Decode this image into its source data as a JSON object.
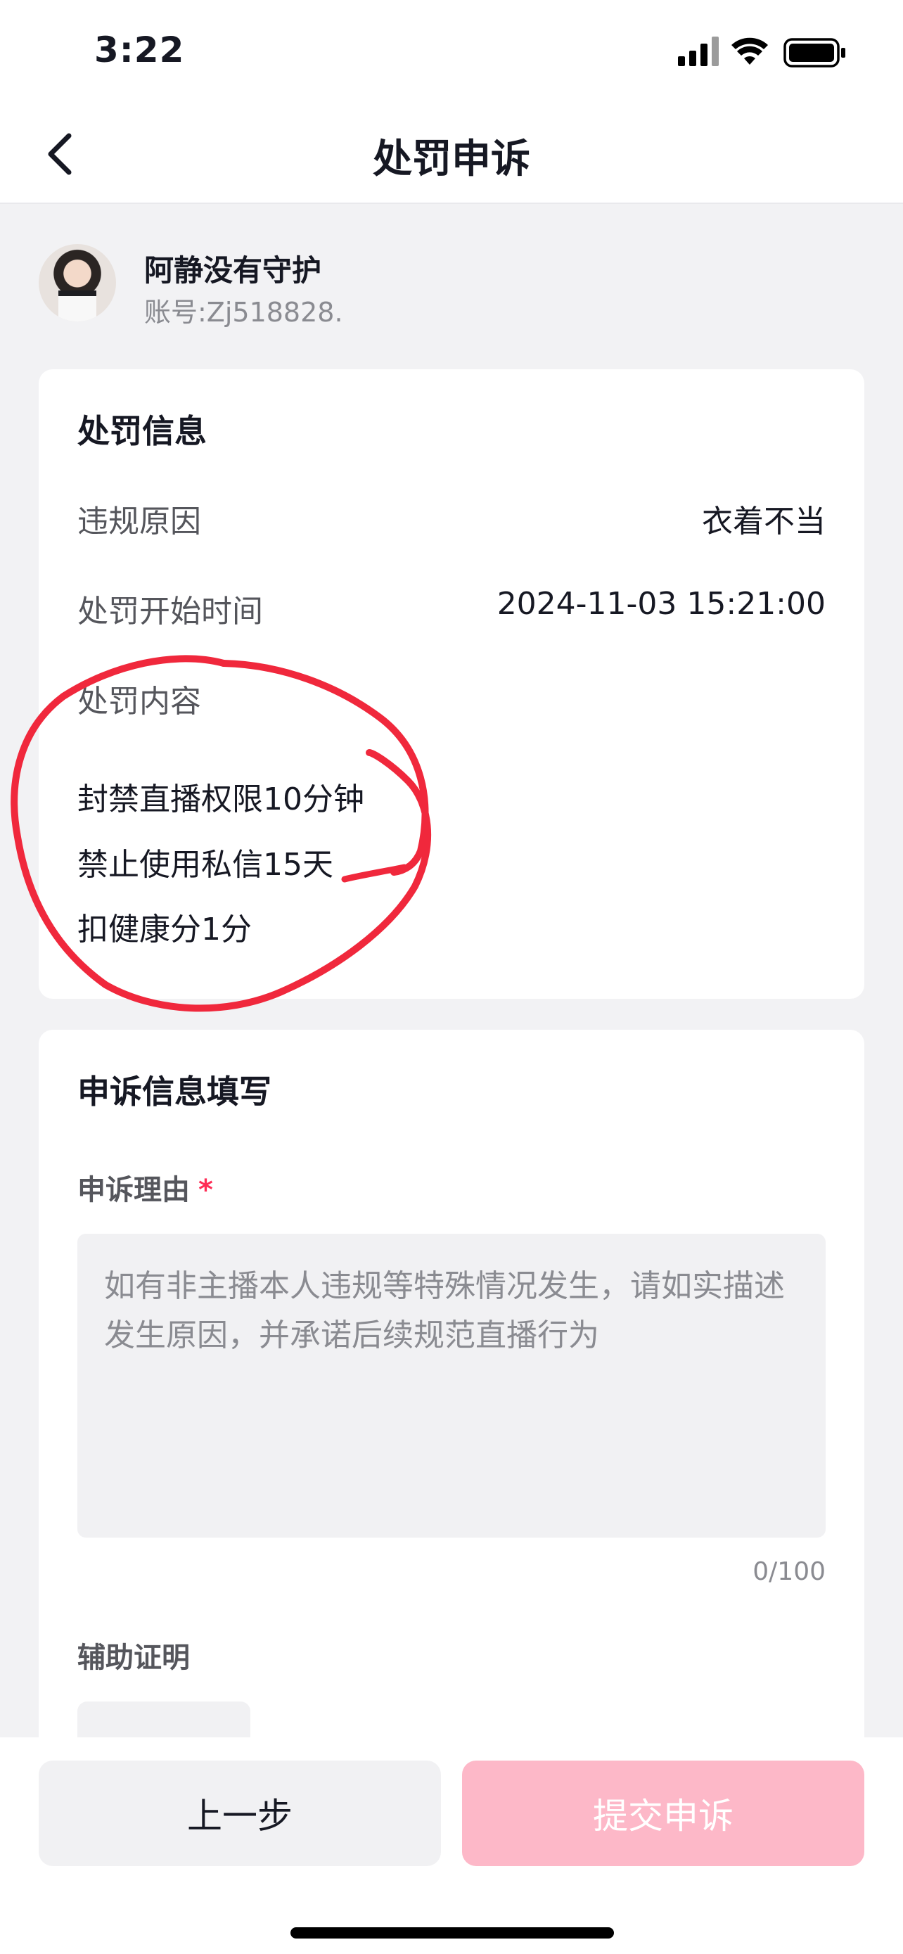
{
  "status_bar": {
    "time": "3:22"
  },
  "nav": {
    "title": "处罚申诉"
  },
  "profile": {
    "name": "阿静没有守护",
    "account": "账号:Zj518828."
  },
  "penalty_card": {
    "title": "处罚信息",
    "reason_label": "违规原因",
    "reason_value": "衣着不当",
    "start_label": "处罚开始时间",
    "start_value": "2024-11-03 15:21:00",
    "content_label": "处罚内容",
    "items": [
      "封禁直播权限10分钟",
      "禁止使用私信15天",
      "扣健康分1分"
    ]
  },
  "appeal_card": {
    "title": "申诉信息填写",
    "reason_label": "申诉理由",
    "required_mark": "*",
    "reason_placeholder": "如有非主播本人违规等特殊情况发生，请如实描述发生原因，并承诺后续规范直播行为",
    "reason_value": "",
    "counter": "0/100",
    "proof_label": "辅助证明"
  },
  "buttons": {
    "prev": "上一步",
    "submit": "提交申诉"
  },
  "colors": {
    "accent": "#fe2c55",
    "submit_disabled": "#fdb8c8",
    "annotation": "#f0283c",
    "background": "#f2f2f4"
  }
}
